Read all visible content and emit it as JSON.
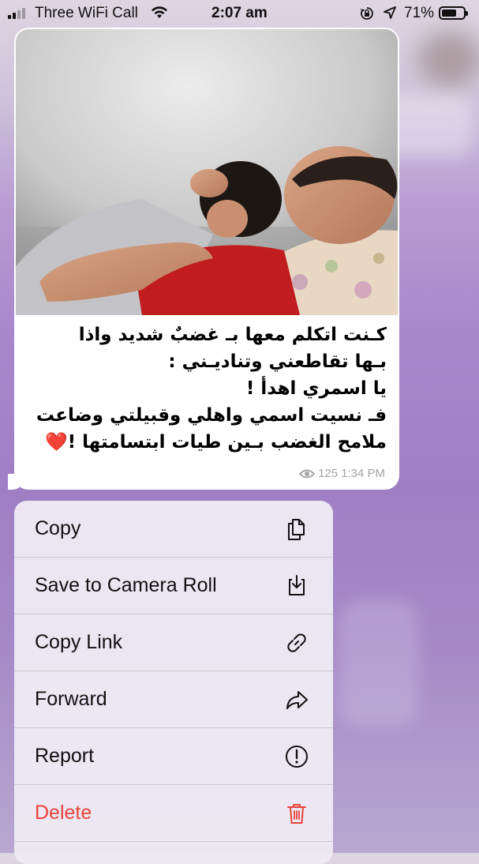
{
  "status_bar": {
    "carrier": "Three WiFi Call",
    "time": "2:07 am",
    "battery_percent": "71%",
    "battery_level": 0.71,
    "icons": [
      "signal-icon",
      "wifi-icon",
      "rotation-lock-icon",
      "location-icon",
      "battery-icon"
    ]
  },
  "message": {
    "text_lines": [
      "كـنت اتكلم معها بـ غضبٌ شديد واذا",
      "بـها تقاطعني وتناديـني :",
      "يا اسمري اهدأ !",
      "فـ نسيت اسمي واهلي وقبيلتي وضاعت",
      "ملامح الغضب بـين طيات ابتسامتها !❤️"
    ],
    "views": "125",
    "time": "1:34 PM",
    "image_icon": "photo-image"
  },
  "menu": {
    "items": [
      {
        "label": "Copy",
        "icon": "copy-icon"
      },
      {
        "label": "Save to Camera Roll",
        "icon": "save-download-icon"
      },
      {
        "label": "Copy Link",
        "icon": "link-icon"
      },
      {
        "label": "Forward",
        "icon": "forward-arrow-icon"
      },
      {
        "label": "Report",
        "icon": "report-exclamation-icon"
      },
      {
        "label": "Delete",
        "icon": "trash-icon"
      }
    ],
    "delete_color": "#e8433a"
  }
}
